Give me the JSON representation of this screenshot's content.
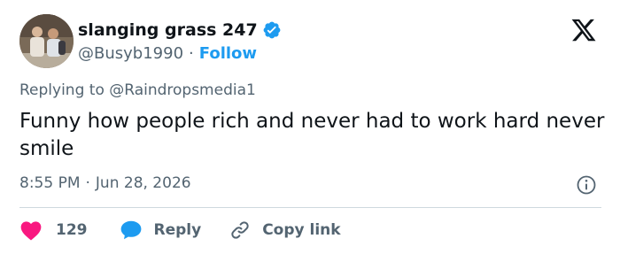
{
  "author": {
    "display_name": "slanging grass 247",
    "handle": "@Busyb1990",
    "separator": "·",
    "follow_label": "Follow",
    "verified": true
  },
  "reply_context": {
    "prefix": "Replying to",
    "mention": "@Raindropsmedia1"
  },
  "tweet": {
    "text": "Funny how people rich and never had to work hard never smile"
  },
  "meta": {
    "time": "8:55 PM",
    "separator": "·",
    "date": "Jun 28, 2026"
  },
  "actions": {
    "like_count": "129",
    "reply_label": "Reply",
    "copy_label": "Copy link"
  },
  "icons": {
    "verified": "verified-badge-icon",
    "platform": "x-logo-icon",
    "info": "info-icon",
    "like": "heart-icon",
    "reply": "speech-bubble-icon",
    "copy": "link-icon"
  },
  "colors": {
    "accent": "#1d9bf0",
    "like": "#f91880",
    "text": "#0f1419",
    "secondary": "#536471",
    "divider": "#cfd9de"
  }
}
